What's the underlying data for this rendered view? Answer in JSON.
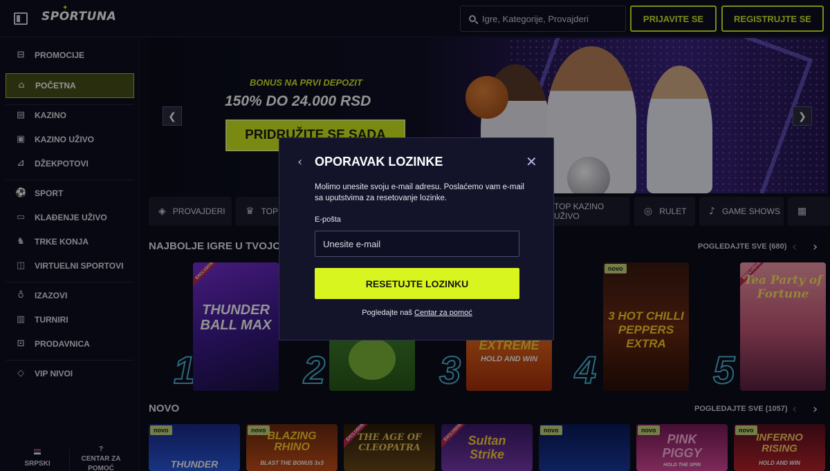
{
  "header": {
    "logo": "SPORTUNA",
    "search_placeholder": "Igre, Kategorije, Provajderi",
    "login_label": "PRIJAVITE SE",
    "register_label": "REGISTRUJTE SE",
    "accent_color": "#d4ef2a"
  },
  "sidebar": {
    "items": [
      {
        "label": "PROMOCIJE",
        "icon": "gift-icon"
      },
      {
        "label": "POČETNA",
        "icon": "home-icon",
        "active": true
      },
      {
        "label": "KAZINO",
        "icon": "cards-icon"
      },
      {
        "label": "KAZINO UŽIVO",
        "icon": "live-casino-icon"
      },
      {
        "label": "DŽEKPOTOVI",
        "icon": "jackpot-icon"
      },
      {
        "label": "SPORT",
        "icon": "soccer-ball-icon"
      },
      {
        "label": "KLAĐENJE UŽIVO",
        "icon": "live-video-icon"
      },
      {
        "label": "TRKE KONJA",
        "icon": "horse-icon"
      },
      {
        "label": "VIRTUELNI SPORTOVI",
        "icon": "gamepad-icon"
      },
      {
        "label": "IZAZOVI",
        "icon": "challenge-icon"
      },
      {
        "label": "TURNIRI",
        "icon": "trophy-icon"
      },
      {
        "label": "PRODAVNICA",
        "icon": "shop-icon"
      },
      {
        "label": "VIP NIVOI",
        "icon": "diamond-icon"
      }
    ],
    "footer": {
      "language": "SRPSKI",
      "help_line1": "CENTAR ZA",
      "help_line2": "POMOĆ"
    }
  },
  "banner": {
    "subtitle": "BONUS NA PRVI DEPOZIT",
    "title": "150% DO 24.000 RSD",
    "cta": "PRIDRUŽITE SE SADA"
  },
  "categories": [
    {
      "label": "PROVAJDERI",
      "icon": "layers-icon"
    },
    {
      "label": "TOP",
      "icon": "crown-icon"
    },
    {
      "label": "TOP KAZINO UŽIVO",
      "icon": "live-icon"
    },
    {
      "label": "RULET",
      "icon": "roulette-icon"
    },
    {
      "label": "GAME SHOWS",
      "icon": "microphone-icon"
    }
  ],
  "top_games": {
    "title": "NAJBOLJE IGRE U TVOJO",
    "see_all": "POGLEDAJTE SVE (680)",
    "games": [
      {
        "rank": "1",
        "name": "THUNDER BALL MAX",
        "tag": "EXCLUSIVE"
      },
      {
        "rank": "2",
        "name": ""
      },
      {
        "rank": "3",
        "name": "EXTREME",
        "sub": "HOLD AND WIN"
      },
      {
        "rank": "4",
        "name": "3 HOT CHILLI PEPPERS EXTRA",
        "badge": "novo"
      },
      {
        "rank": "5",
        "name": "Tea Party of Fortune",
        "tag": "EXCLUSIVE"
      }
    ]
  },
  "new_games": {
    "title": "NOVO",
    "see_all": "POGLEDAJTE SVE (1057)",
    "games": [
      {
        "name": "THUNDER",
        "badge": "novo"
      },
      {
        "name": "BLAZING RHINO",
        "sub": "BLAST THE BONUS 3x3",
        "badge": "novo"
      },
      {
        "name": "THE AGE OF CLEOPATRA",
        "tag": "EXCLUSIVE"
      },
      {
        "name": "Sultan Strike",
        "tag": "EXCLUSIVE"
      },
      {
        "name": "",
        "badge": "novo"
      },
      {
        "name": "PINK PIGGY",
        "sub": "HOLD THE SPIN",
        "badge": "novo"
      },
      {
        "name": "INFERNO RISING",
        "sub": "HOLD AND WIN",
        "badge": "novo"
      }
    ]
  },
  "modal": {
    "title": "OPORAVAK LOZINKE",
    "description": "Molimo unesite svoju e-mail adresu. Poslaćemo vam e-mail sa uputstvima za resetovanje lozinke.",
    "email_label": "E-pošta",
    "email_placeholder": "Unesite e-mail",
    "email_value": "",
    "submit_label": "RESETUJTE LOZINKU",
    "help_prefix": "Pogledajte naš",
    "help_link": "Centar za pomoć"
  }
}
